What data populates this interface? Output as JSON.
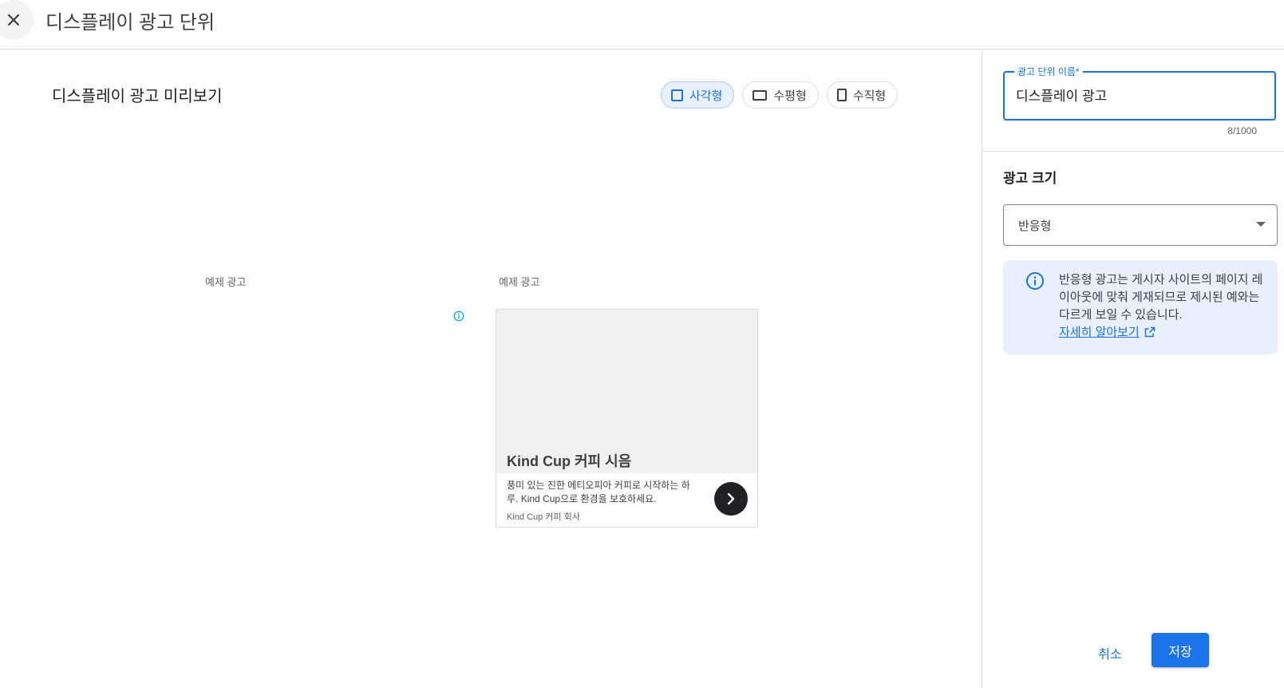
{
  "header": {
    "title": "디스플레이 광고 단위"
  },
  "preview": {
    "title": "디스플레이 광고 미리보기",
    "shapes": [
      {
        "label": "사각형",
        "icon": "square-icon",
        "active": true
      },
      {
        "label": "수평형",
        "icon": "horizontal-rect-icon",
        "active": false
      },
      {
        "label": "수직형",
        "icon": "vertical-rect-icon",
        "active": false
      }
    ],
    "example_label_left": "예제 광고",
    "example_label_right": "예제 광고",
    "ad": {
      "headline": "Kind Cup 커피 시음",
      "description": "풍미 있는 진한 에티오피아 커피로 시작하는 하루. Kind Cup으로 환경을 보호하세요.",
      "brand": "Kind Cup 커피 회사"
    }
  },
  "side": {
    "name_field": {
      "label": "광고 단위 이름*",
      "value": "디스플레이 광고",
      "count": "8/1000"
    },
    "size_title": "광고 크기",
    "size_select": {
      "value": "반응형"
    },
    "info": {
      "text": "반응형 광고는 게시자 사이트의 페이지 레이아웃에 맞춰 게재되므로 제시된 예와는 다르게 보일 수 있습니다.",
      "link": "자세히 알아보기"
    },
    "cancel_label": "취소",
    "save_label": "저장"
  },
  "colors": {
    "accent": "#1a73e8",
    "info_bg": "#e8f0fe",
    "chip_active_bg": "#e8f0fe"
  }
}
